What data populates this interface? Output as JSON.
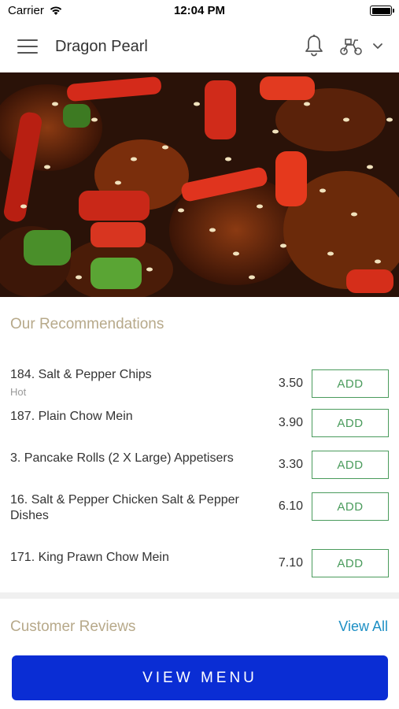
{
  "status_bar": {
    "carrier": "Carrier",
    "time": "12:04 PM"
  },
  "header": {
    "restaurant_name": "Dragon Pearl",
    "icons": [
      "menu-icon",
      "bell-icon",
      "delivery-scooter-icon",
      "chevron-down-icon"
    ]
  },
  "hero": {
    "description_icon": "food-photo"
  },
  "recommendations": {
    "title": "Our Recommendations",
    "items": [
      {
        "name": "184. Salt & Pepper Chips",
        "sub": "Hot",
        "price": "3.50",
        "button": "ADD"
      },
      {
        "name": "187. Plain Chow Mein",
        "sub": "",
        "price": "3.90",
        "button": "ADD"
      },
      {
        "name": "3. Pancake Rolls (2 X Large) Appetisers",
        "sub": "",
        "price": "3.30",
        "button": "ADD"
      },
      {
        "name": "16. Salt & Pepper Chicken Salt & Pepper Dishes",
        "sub": "",
        "price": "6.10",
        "button": "ADD"
      },
      {
        "name": "171. King Prawn Chow Mein",
        "sub": "",
        "price": "7.10",
        "button": "ADD"
      }
    ]
  },
  "reviews": {
    "title": "Customer Reviews",
    "view_all": "View All"
  },
  "footer": {
    "view_menu_label": "VIEW MENU"
  },
  "colors": {
    "accent_gold": "#b7a98a",
    "add_green": "#4a9b5c",
    "link_blue": "#1d8fc4",
    "primary_blue": "#0a2dd4"
  }
}
